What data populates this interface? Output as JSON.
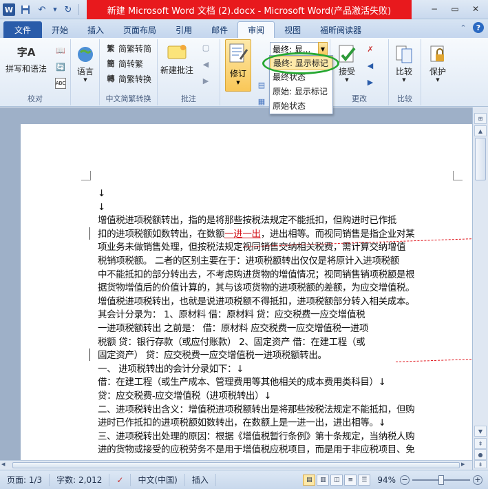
{
  "window": {
    "title": "新建 Microsoft Word 文档 (2).docx  -  Microsoft Word(产品激活失败)",
    "app_logo": "W"
  },
  "tabs": [
    "文件",
    "开始",
    "插入",
    "页面布局",
    "引用",
    "邮件",
    "审阅",
    "视图",
    "福昕阅读器"
  ],
  "active_tab": "审阅",
  "ribbon": {
    "proofing": {
      "spell_label": "拼写和语法",
      "group": "校对",
      "big_glyph": "字A"
    },
    "language": {
      "label": "语言"
    },
    "chinese": {
      "trad_to_simp_1": "简繁转简",
      "simp_to_trad": "简转繁",
      "convert": "简繁转换",
      "group": "中文简繁转换"
    },
    "comments": {
      "new_comment": "新建批注",
      "group": "批注"
    },
    "tracking": {
      "modify": "修订",
      "display_value": "最终: 显...",
      "group": ""
    },
    "changes": {
      "accept": "接受",
      "group": "更改"
    },
    "compare": {
      "label": "比较",
      "group": "比较"
    },
    "protect": {
      "label": "保护"
    }
  },
  "dropdown_options": [
    "最终: 显示标记",
    "最终状态",
    "原始: 显示标记",
    "原始状态"
  ],
  "document": {
    "lines": [
      "↓",
      "↓",
      "        增值税进项税额转出，指的是将那些按税法规定不能抵扣，但购进时已作抵",
      "扣的进项税额如数转出，在数额一进一出，进出相等。而视同销售是指企业对某",
      "项业务未做销售处理，但按税法规定视同销售交纳相关税费，需计算交纳增值",
      "税销项税额。      二者的区别主要在于：进项税额转出仅仅是将原计入进项税额",
      "中不能抵扣的部分转出去，不考虑购进货物的增值情况；视同销售销项税额是根",
      "据货物增值后的价值计算的，其与该项货物的进项税额的差额，为应交增值税。",
      "增值税进项税转出，也就是说进项税额不得抵扣，进项税额部分转入相关成本。",
      "其会计分录为：      1、原材料      借：原材料      贷：应交税费一应交增值税",
      "一进项税额转出      之前是：      借：原材料      应交税费一应交增值税一进项",
      "税额      贷：银行存款（或应付账款）      2、固定资产      借：在建工程（或",
      "固定资产）      贷：应交税费一应交增值税一进项税额转出。",
      "一、    进项税转出的会计分录如下：↓",
      "借：在建工程（或生产成本、管理费用等其他相关的成本费用类科目）↓",
      "                    贷：应交税费-应交增值税（进项税转出）↓",
      "二、进项税转出含义：增值税进项税额转出是将那些按税法规定不能抵扣，但购",
      "进时已作抵扣的进项税额如数转出，在数额上是一进一出，进出相等。↓",
      "三、进项税转出处理的原因：根据《增值税暂行条例》第十条规定，当纳税人购",
      "进的货物或接受的应税劳务不是用于增值税应税项目，而是用于非应税项目、免"
    ],
    "inserted_text": "一进一出",
    "line3_before": "扣的进项税额如数转出，在数额",
    "line3_after": "，进出相等。而视同销售是指企业对某"
  },
  "statusbar": {
    "page": "页面: 1/3",
    "words": "字数: 2,012",
    "language": "中文(中国)",
    "mode": "插入",
    "zoom": "94%"
  },
  "colors": {
    "title_red": "#e8191d",
    "accent_blue": "#2a5caa",
    "insert_red": "#d2141b",
    "highlight_green": "#27a833"
  }
}
